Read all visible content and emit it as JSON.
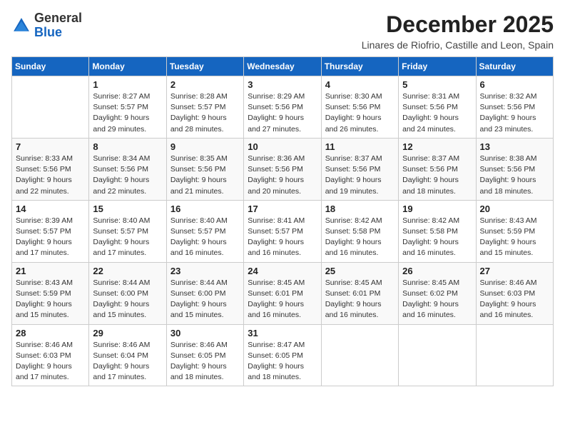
{
  "logo": {
    "general": "General",
    "blue": "Blue"
  },
  "header": {
    "title": "December 2025",
    "subtitle": "Linares de Riofrio, Castille and Leon, Spain"
  },
  "weekdays": [
    "Sunday",
    "Monday",
    "Tuesday",
    "Wednesday",
    "Thursday",
    "Friday",
    "Saturday"
  ],
  "weeks": [
    [
      {
        "day": "",
        "sunrise": "",
        "sunset": "",
        "daylight": ""
      },
      {
        "day": "1",
        "sunrise": "Sunrise: 8:27 AM",
        "sunset": "Sunset: 5:57 PM",
        "daylight": "Daylight: 9 hours and 29 minutes."
      },
      {
        "day": "2",
        "sunrise": "Sunrise: 8:28 AM",
        "sunset": "Sunset: 5:57 PM",
        "daylight": "Daylight: 9 hours and 28 minutes."
      },
      {
        "day": "3",
        "sunrise": "Sunrise: 8:29 AM",
        "sunset": "Sunset: 5:56 PM",
        "daylight": "Daylight: 9 hours and 27 minutes."
      },
      {
        "day": "4",
        "sunrise": "Sunrise: 8:30 AM",
        "sunset": "Sunset: 5:56 PM",
        "daylight": "Daylight: 9 hours and 26 minutes."
      },
      {
        "day": "5",
        "sunrise": "Sunrise: 8:31 AM",
        "sunset": "Sunset: 5:56 PM",
        "daylight": "Daylight: 9 hours and 24 minutes."
      },
      {
        "day": "6",
        "sunrise": "Sunrise: 8:32 AM",
        "sunset": "Sunset: 5:56 PM",
        "daylight": "Daylight: 9 hours and 23 minutes."
      }
    ],
    [
      {
        "day": "7",
        "sunrise": "Sunrise: 8:33 AM",
        "sunset": "Sunset: 5:56 PM",
        "daylight": "Daylight: 9 hours and 22 minutes."
      },
      {
        "day": "8",
        "sunrise": "Sunrise: 8:34 AM",
        "sunset": "Sunset: 5:56 PM",
        "daylight": "Daylight: 9 hours and 22 minutes."
      },
      {
        "day": "9",
        "sunrise": "Sunrise: 8:35 AM",
        "sunset": "Sunset: 5:56 PM",
        "daylight": "Daylight: 9 hours and 21 minutes."
      },
      {
        "day": "10",
        "sunrise": "Sunrise: 8:36 AM",
        "sunset": "Sunset: 5:56 PM",
        "daylight": "Daylight: 9 hours and 20 minutes."
      },
      {
        "day": "11",
        "sunrise": "Sunrise: 8:37 AM",
        "sunset": "Sunset: 5:56 PM",
        "daylight": "Daylight: 9 hours and 19 minutes."
      },
      {
        "day": "12",
        "sunrise": "Sunrise: 8:37 AM",
        "sunset": "Sunset: 5:56 PM",
        "daylight": "Daylight: 9 hours and 18 minutes."
      },
      {
        "day": "13",
        "sunrise": "Sunrise: 8:38 AM",
        "sunset": "Sunset: 5:56 PM",
        "daylight": "Daylight: 9 hours and 18 minutes."
      }
    ],
    [
      {
        "day": "14",
        "sunrise": "Sunrise: 8:39 AM",
        "sunset": "Sunset: 5:57 PM",
        "daylight": "Daylight: 9 hours and 17 minutes."
      },
      {
        "day": "15",
        "sunrise": "Sunrise: 8:40 AM",
        "sunset": "Sunset: 5:57 PM",
        "daylight": "Daylight: 9 hours and 17 minutes."
      },
      {
        "day": "16",
        "sunrise": "Sunrise: 8:40 AM",
        "sunset": "Sunset: 5:57 PM",
        "daylight": "Daylight: 9 hours and 16 minutes."
      },
      {
        "day": "17",
        "sunrise": "Sunrise: 8:41 AM",
        "sunset": "Sunset: 5:57 PM",
        "daylight": "Daylight: 9 hours and 16 minutes."
      },
      {
        "day": "18",
        "sunrise": "Sunrise: 8:42 AM",
        "sunset": "Sunset: 5:58 PM",
        "daylight": "Daylight: 9 hours and 16 minutes."
      },
      {
        "day": "19",
        "sunrise": "Sunrise: 8:42 AM",
        "sunset": "Sunset: 5:58 PM",
        "daylight": "Daylight: 9 hours and 16 minutes."
      },
      {
        "day": "20",
        "sunrise": "Sunrise: 8:43 AM",
        "sunset": "Sunset: 5:59 PM",
        "daylight": "Daylight: 9 hours and 15 minutes."
      }
    ],
    [
      {
        "day": "21",
        "sunrise": "Sunrise: 8:43 AM",
        "sunset": "Sunset: 5:59 PM",
        "daylight": "Daylight: 9 hours and 15 minutes."
      },
      {
        "day": "22",
        "sunrise": "Sunrise: 8:44 AM",
        "sunset": "Sunset: 6:00 PM",
        "daylight": "Daylight: 9 hours and 15 minutes."
      },
      {
        "day": "23",
        "sunrise": "Sunrise: 8:44 AM",
        "sunset": "Sunset: 6:00 PM",
        "daylight": "Daylight: 9 hours and 15 minutes."
      },
      {
        "day": "24",
        "sunrise": "Sunrise: 8:45 AM",
        "sunset": "Sunset: 6:01 PM",
        "daylight": "Daylight: 9 hours and 16 minutes."
      },
      {
        "day": "25",
        "sunrise": "Sunrise: 8:45 AM",
        "sunset": "Sunset: 6:01 PM",
        "daylight": "Daylight: 9 hours and 16 minutes."
      },
      {
        "day": "26",
        "sunrise": "Sunrise: 8:45 AM",
        "sunset": "Sunset: 6:02 PM",
        "daylight": "Daylight: 9 hours and 16 minutes."
      },
      {
        "day": "27",
        "sunrise": "Sunrise: 8:46 AM",
        "sunset": "Sunset: 6:03 PM",
        "daylight": "Daylight: 9 hours and 16 minutes."
      }
    ],
    [
      {
        "day": "28",
        "sunrise": "Sunrise: 8:46 AM",
        "sunset": "Sunset: 6:03 PM",
        "daylight": "Daylight: 9 hours and 17 minutes."
      },
      {
        "day": "29",
        "sunrise": "Sunrise: 8:46 AM",
        "sunset": "Sunset: 6:04 PM",
        "daylight": "Daylight: 9 hours and 17 minutes."
      },
      {
        "day": "30",
        "sunrise": "Sunrise: 8:46 AM",
        "sunset": "Sunset: 6:05 PM",
        "daylight": "Daylight: 9 hours and 18 minutes."
      },
      {
        "day": "31",
        "sunrise": "Sunrise: 8:47 AM",
        "sunset": "Sunset: 6:05 PM",
        "daylight": "Daylight: 9 hours and 18 minutes."
      },
      {
        "day": "",
        "sunrise": "",
        "sunset": "",
        "daylight": ""
      },
      {
        "day": "",
        "sunrise": "",
        "sunset": "",
        "daylight": ""
      },
      {
        "day": "",
        "sunrise": "",
        "sunset": "",
        "daylight": ""
      }
    ]
  ]
}
